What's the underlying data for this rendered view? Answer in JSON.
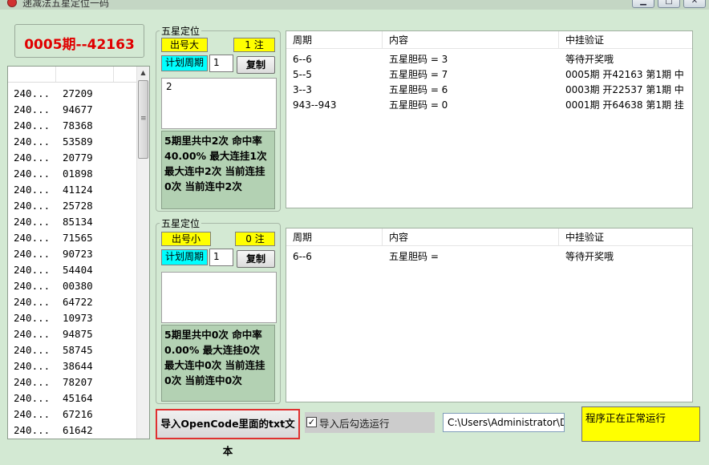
{
  "window": {
    "title": "递减法五星定位一码",
    "buttons": {
      "minimize": "▁",
      "maximize": "□",
      "close": "✕"
    }
  },
  "period_display": "0005期--42163",
  "history": {
    "rows": [
      {
        "issue": "240...",
        "number": "27209"
      },
      {
        "issue": "240...",
        "number": "94677"
      },
      {
        "issue": "240...",
        "number": "78368"
      },
      {
        "issue": "240...",
        "number": "53589"
      },
      {
        "issue": "240...",
        "number": "20779"
      },
      {
        "issue": "240...",
        "number": "01898"
      },
      {
        "issue": "240...",
        "number": "41124"
      },
      {
        "issue": "240...",
        "number": "25728"
      },
      {
        "issue": "240...",
        "number": "85134"
      },
      {
        "issue": "240...",
        "number": "71565"
      },
      {
        "issue": "240...",
        "number": "90723"
      },
      {
        "issue": "240...",
        "number": "54404"
      },
      {
        "issue": "240...",
        "number": "00380"
      },
      {
        "issue": "240...",
        "number": "64722"
      },
      {
        "issue": "240...",
        "number": "10973"
      },
      {
        "issue": "240...",
        "number": "94875"
      },
      {
        "issue": "240...",
        "number": "58745"
      },
      {
        "issue": "240...",
        "number": "38644"
      },
      {
        "issue": "240...",
        "number": "78207"
      },
      {
        "issue": "240...",
        "number": "45164"
      },
      {
        "issue": "240...",
        "number": "67216"
      },
      {
        "issue": "240...",
        "number": "61642"
      }
    ]
  },
  "panel1": {
    "group_title": "五星定位",
    "mode_label": "出号大",
    "count_label": "1 注",
    "plan_label": "计划周期",
    "plan_value": "1",
    "copy_label": "复制",
    "output_text": "2",
    "stats": "5期里共中2次 命中率40.00% 最大连挂1次 最大连中2次 当前连挂0次 当前连中2次"
  },
  "panel2": {
    "group_title": "五星定位",
    "mode_label": "出号小",
    "count_label": "0 注",
    "plan_label": "计划周期",
    "plan_value": "1",
    "copy_label": "复制",
    "output_text": "",
    "stats": "5期里共中0次 命中率0.00% 最大连挂0次 最大连中0次 当前连挂0次 当前连中0次"
  },
  "table1": {
    "headers": [
      "周期",
      "内容",
      "中挂验证"
    ],
    "rows": [
      {
        "period": "6--6",
        "content": "五星胆码 = 3",
        "verify": "等待开奖哦"
      },
      {
        "period": "5--5",
        "content": "五星胆码 = 7",
        "verify": "0005期 开42163 第1期 中"
      },
      {
        "period": "3--3",
        "content": "五星胆码 = 6",
        "verify": "0003期 开22537 第1期 中"
      },
      {
        "period": "943--943",
        "content": "五星胆码 = 0",
        "verify": "0001期 开64638 第1期 挂"
      }
    ]
  },
  "table2": {
    "headers": [
      "周期",
      "内容",
      "中挂验证"
    ],
    "rows": [
      {
        "period": "6--6",
        "content": "五星胆码 =",
        "verify": "等待开奖哦"
      }
    ]
  },
  "bottom": {
    "import_button": "导入OpenCode里面的txt文本",
    "auto_run_label": "导入后勾选运行",
    "auto_run_checked": true,
    "path_value": "C:\\Users\\Administrator\\De",
    "status_text": "程序正在正常运行"
  },
  "colors": {
    "background": "#d3e9d3",
    "period_red": "#e00000",
    "highlight_yellow": "#ffff00",
    "highlight_cyan": "#00ffff",
    "stats_green": "#b3d1b3"
  }
}
